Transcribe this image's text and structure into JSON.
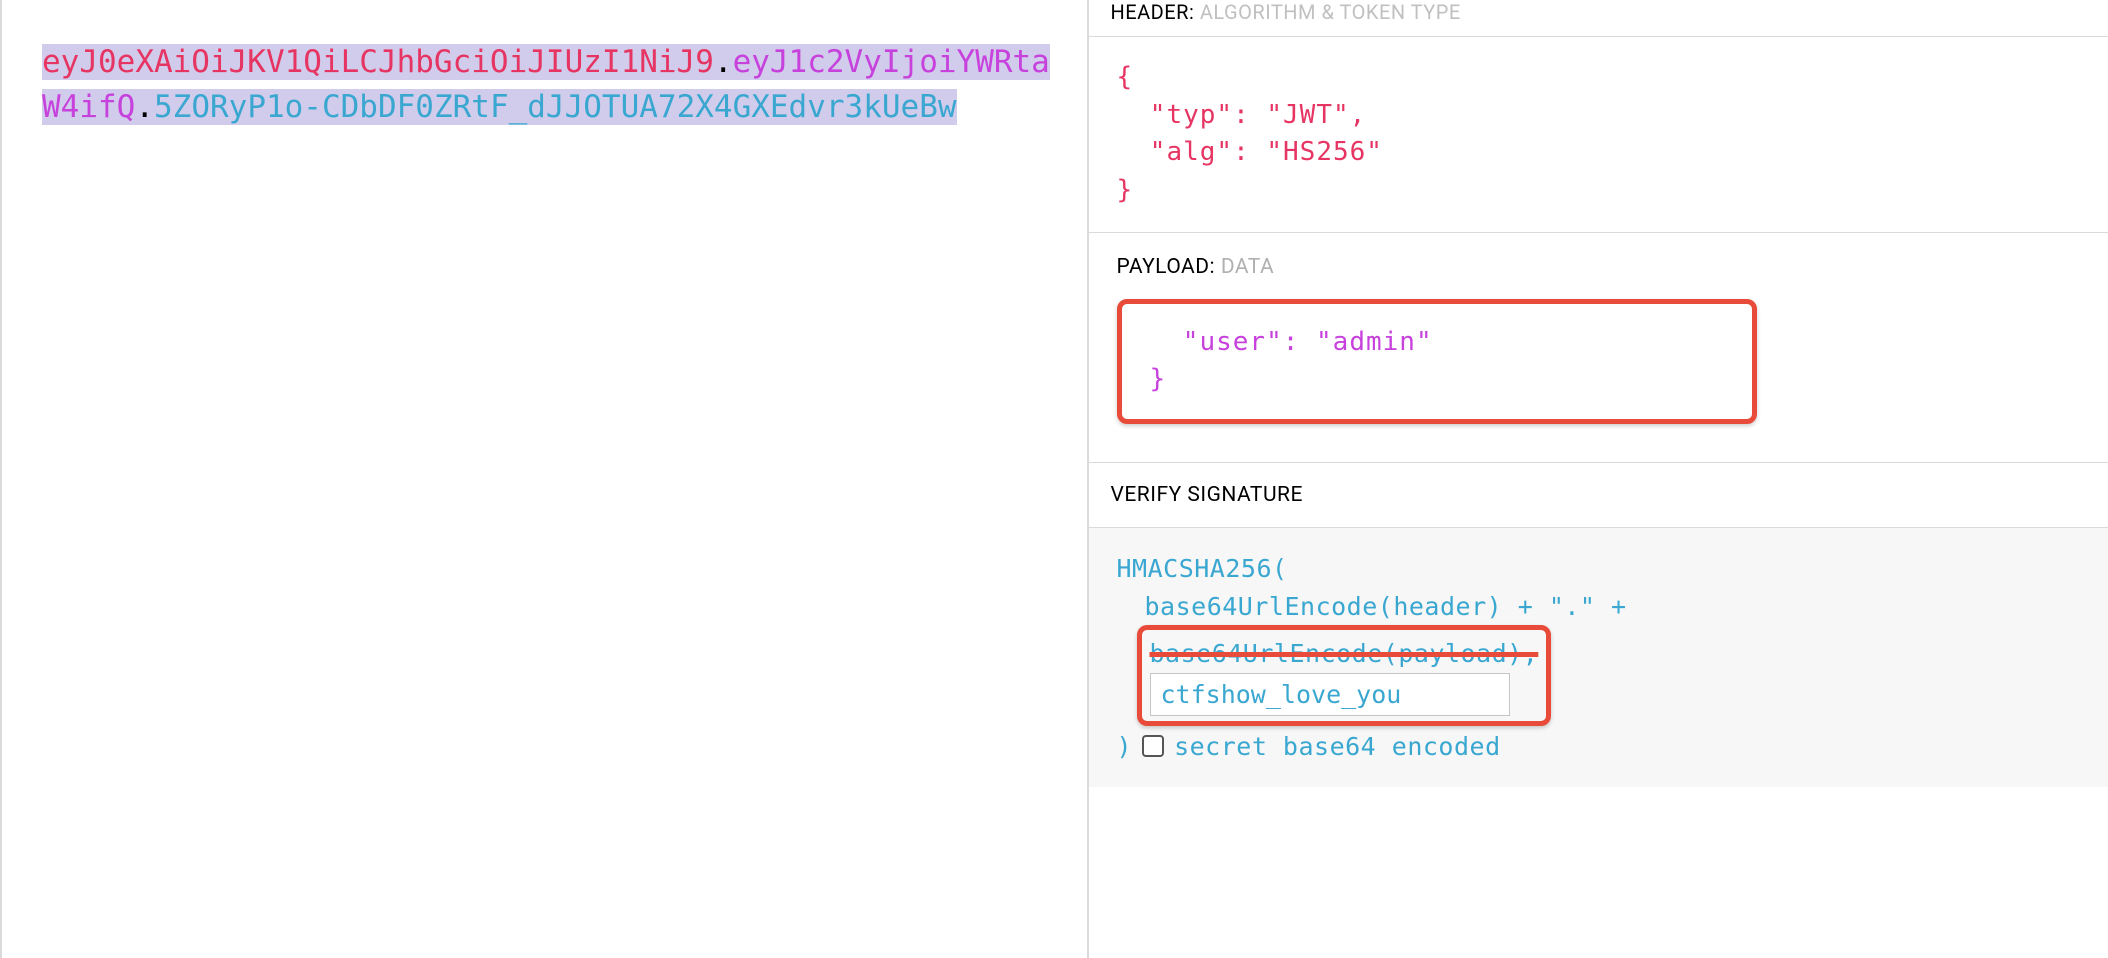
{
  "left": {
    "jwt": {
      "header": "eyJ0eXAiOiJKV1QiLCJhbGciOiJIUzI1NiJ9",
      "payload": "eyJ1c2VyIjoiYWRtaW4ifQ",
      "signature": "5ZORyP1o-CDbDF0ZRtF_dJJOTUA72X4GXEdvr3kUeBw",
      "dot": "."
    }
  },
  "right": {
    "headerSection": {
      "title": "HEADER:",
      "subtitle": "ALGORITHM & TOKEN TYPE",
      "code": {
        "open": "{",
        "line1": "  \"typ\": \"JWT\",",
        "line2": "  \"alg\": \"HS256\"",
        "close": "}"
      }
    },
    "payloadSection": {
      "title": "PAYLOAD:",
      "subtitle": "DATA",
      "code": {
        "line1": "  \"user\": \"admin\"",
        "close": "}"
      }
    },
    "verifySection": {
      "title": "VERIFY SIGNATURE",
      "code": {
        "line1": "HMACSHA256(",
        "line2": "base64UrlEncode(header) + \".\" +",
        "line3": "base64UrlEncode(payload),",
        "secret": "ctfshow_love_you",
        "closeParen": ")",
        "checkboxLabel": "secret base64 encoded"
      }
    }
  }
}
